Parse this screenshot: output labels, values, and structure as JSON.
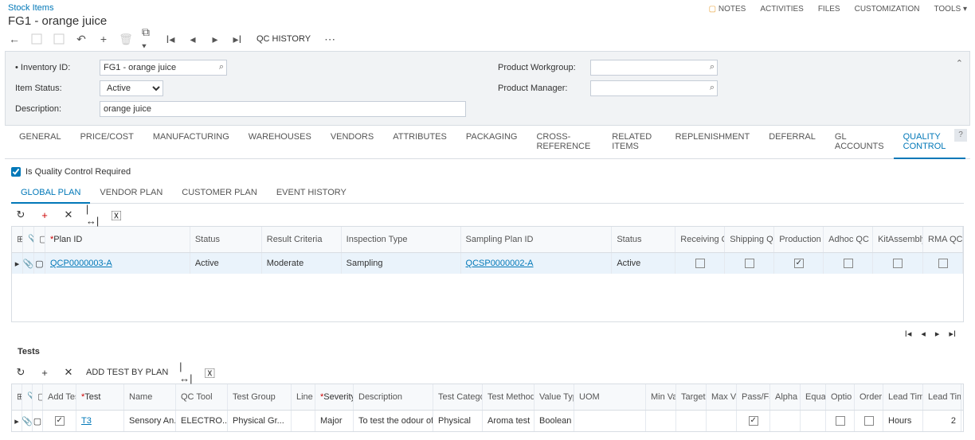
{
  "breadcrumb": "Stock Items",
  "title": "FG1 - orange juice",
  "topnav": {
    "notes": "NOTES",
    "activities": "ACTIVITIES",
    "files": "FILES",
    "customization": "CUSTOMIZATION",
    "tools": "TOOLS"
  },
  "toolbar": {
    "qc_history": "QC HISTORY"
  },
  "form": {
    "inventory_id_lbl": "Inventory ID:",
    "inventory_id": "FG1 - orange juice",
    "item_status_lbl": "Item Status:",
    "item_status": "Active",
    "description_lbl": "Description:",
    "description": "orange juice",
    "workgroup_lbl": "Product Workgroup:",
    "workgroup": "",
    "manager_lbl": "Product Manager:",
    "manager": ""
  },
  "tabs": [
    "GENERAL",
    "PRICE/COST",
    "MANUFACTURING",
    "WAREHOUSES",
    "VENDORS",
    "ATTRIBUTES",
    "PACKAGING",
    "CROSS-REFERENCE",
    "RELATED ITEMS",
    "REPLENISHMENT",
    "DEFERRAL",
    "GL ACCOUNTS",
    "QUALITY CONTROL"
  ],
  "active_tab": "QUALITY CONTROL",
  "qc_required_lbl": "Is Quality Control Required",
  "subtabs": [
    "GLOBAL PLAN",
    "VENDOR PLAN",
    "CUSTOMER PLAN",
    "EVENT HISTORY"
  ],
  "active_subtab": "GLOBAL PLAN",
  "plan_grid": {
    "headers": {
      "plan_id": "Plan ID",
      "status": "Status",
      "result": "Result Criteria",
      "insp": "Inspection Type",
      "samp_id": "Sampling Plan ID",
      "status2": "Status",
      "recv": "Receiving QC",
      "ship": "Shipping QC",
      "prod": "Production QC",
      "adhoc": "Adhoc QC",
      "kit": "KitAssembly QC",
      "rma": "RMA QC"
    },
    "row": {
      "plan_id": "QCP0000003-A",
      "status": "Active",
      "result": "Moderate",
      "insp": "Sampling",
      "samp_id": "QCSP0000002-A",
      "status2": "Active",
      "recv": false,
      "ship": false,
      "prod": true,
      "adhoc": false,
      "kit": false,
      "rma": false
    }
  },
  "tests_title": "Tests",
  "tests_toolbar": {
    "add_by_plan": "ADD TEST BY PLAN"
  },
  "tests_grid": {
    "headers": {
      "add": "Add Test In Reporti",
      "test": "Test",
      "name": "Name",
      "tool": "QC Tool",
      "group": "Test Group",
      "line": "Line Nbr",
      "sev": "Severity Level",
      "desc": "Description",
      "cat": "Test Category",
      "method": "Test Method",
      "vtype": "Value Type",
      "uom": "UOM",
      "min": "Min Value",
      "targ": "Target Value",
      "max": "Max Value",
      "pf": "Pass/Fa",
      "alpha": "Alpha Value",
      "eq": "Equa",
      "opt": "Optio Test",
      "ord": "Order Level Test",
      "lttype": "Lead Time Duration Type",
      "lt": "Lead Time Duration"
    },
    "row": {
      "add": true,
      "test": "T3",
      "name": "Sensory An...",
      "tool": "ELECTRO...",
      "group": "Physical Gr...",
      "line": "",
      "sev": "Major",
      "desc": "To test the odour of t...",
      "cat": "Physical",
      "method": "Aroma test",
      "vtype": "Boolean",
      "uom": "",
      "min": "",
      "targ": "",
      "max": "",
      "pf": true,
      "alpha": "",
      "eq": "",
      "opt": false,
      "ord": false,
      "lttype": "Hours",
      "lt": "2"
    }
  }
}
